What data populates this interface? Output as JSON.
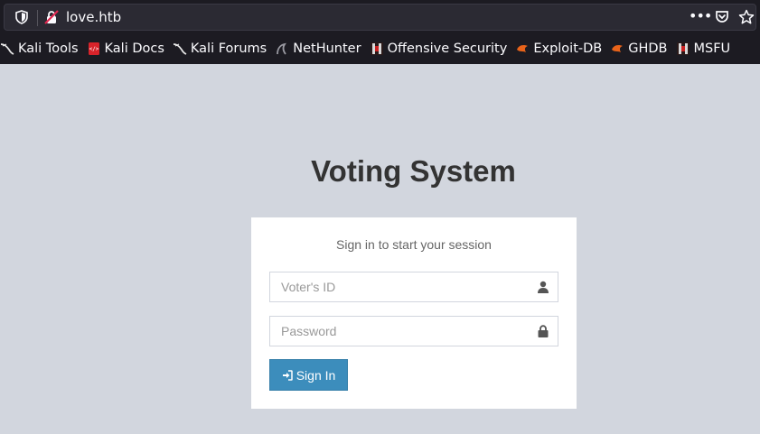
{
  "browser": {
    "url": "love.htb",
    "bookmarks": [
      {
        "label": "Kali Tools",
        "icon": "kali-dragon-icon"
      },
      {
        "label": "Kali Docs",
        "icon": "kali-docs-icon"
      },
      {
        "label": "Kali Forums",
        "icon": "kali-dragon-icon"
      },
      {
        "label": "NetHunter",
        "icon": "nethunter-icon"
      },
      {
        "label": "Offensive Security",
        "icon": "offsec-icon"
      },
      {
        "label": "Exploit-DB",
        "icon": "exploit-db-icon"
      },
      {
        "label": "GHDB",
        "icon": "exploit-db-icon"
      },
      {
        "label": "MSFU",
        "icon": "offsec-icon"
      }
    ]
  },
  "page": {
    "title": "Voting System",
    "login_message": "Sign in to start your session",
    "voter_id": {
      "placeholder": "Voter's ID",
      "value": "",
      "icon": "user-icon"
    },
    "password": {
      "placeholder": "Password",
      "value": "",
      "icon": "lock-icon"
    },
    "signin_label": "Sign In",
    "signin_icon": "sign-in-icon"
  },
  "colors": {
    "page_bg": "#d2d6de",
    "button": "#3c8dbc",
    "chrome_bg": "#1c1b22"
  }
}
